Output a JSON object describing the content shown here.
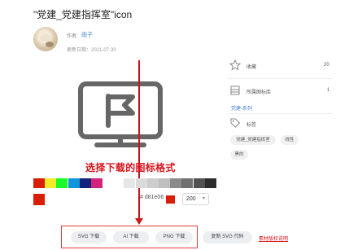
{
  "title": "\"党建_党建指挥室\"icon",
  "author": {
    "label": "作者:",
    "name": "雨子"
  },
  "updated": "更新日期：2021-07-30",
  "annotation": {
    "text": "选择下载的图标格式"
  },
  "palette": {
    "colors": [
      "#d81e06",
      "#f4ea2a",
      "#1afa29",
      "#1296db",
      "#13227a",
      "#d4237a",
      "#ffffff",
      "#e6e6e6",
      "#dbdbdb",
      "#cdcdcd",
      "#bfbfbf",
      "#8a8a8a",
      "#707070",
      "#515151",
      "#2c2c2c"
    ],
    "selected": "#d81e06"
  },
  "hex": {
    "label": "#",
    "value": "d81e06"
  },
  "size": {
    "value": "200",
    "arrow": "▾"
  },
  "buttons": {
    "svg": "SVG 下载",
    "ai": "AI 下载",
    "png": "PNG 下载",
    "copy": "复制 SVG 代码"
  },
  "link": "素材版权说明",
  "sidebar": {
    "favorite": {
      "label": "收藏",
      "count": "20"
    },
    "library": {
      "label": "所属图标库",
      "count": "1"
    },
    "series": "党建-系列",
    "tags_label": "标签",
    "tags": [
      "党建_党建指挥室",
      "线性",
      "黑的"
    ]
  }
}
